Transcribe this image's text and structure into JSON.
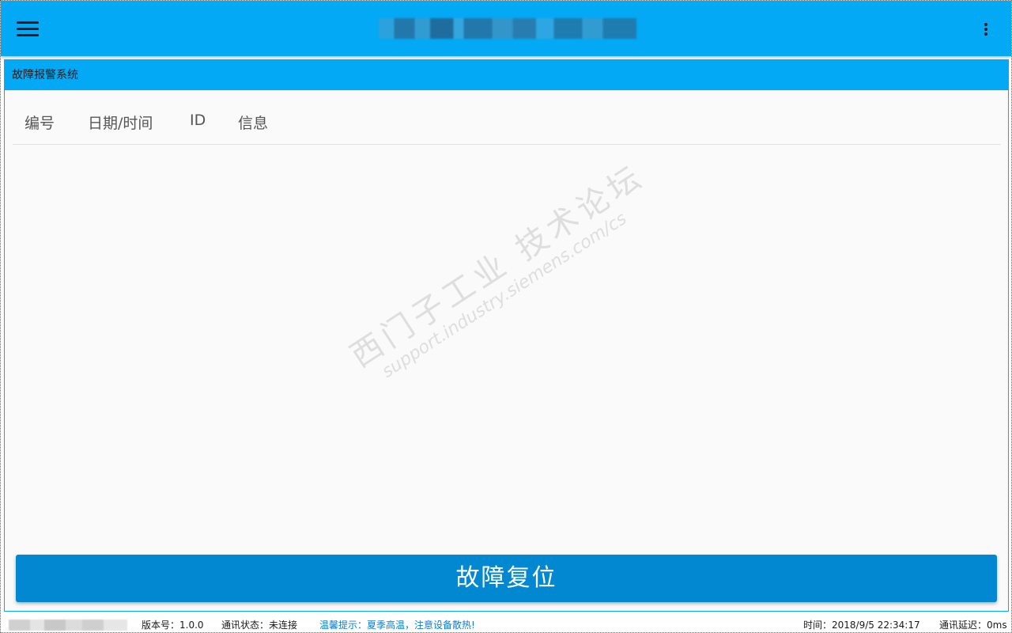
{
  "appbar": {
    "menu_icon": "hamburger-menu-icon",
    "title": "",
    "more_icon": "more-vertical-icon"
  },
  "panel": {
    "title": "故障报警系统",
    "columns": [
      "编号",
      "日期/时间",
      "ID",
      "信息"
    ],
    "rows": [],
    "reset_button": "故障复位",
    "watermark": {
      "line1": "西门子工业 技术论坛",
      "line2": "support.industry.siemens.com/cs"
    }
  },
  "statusbar": {
    "version": "版本号：1.0.0",
    "connection": "通讯状态：未连接",
    "tip": "温馨提示：夏季高温，注意设备散热!",
    "time": "时间：2018/9/5 22:34:17",
    "latency": "通讯延迟：0ms",
    "tip_color": "#0b7dd6"
  },
  "colors": {
    "primary": "#03a9f4",
    "button": "#0288d1",
    "panel_bg": "#fafafa"
  }
}
